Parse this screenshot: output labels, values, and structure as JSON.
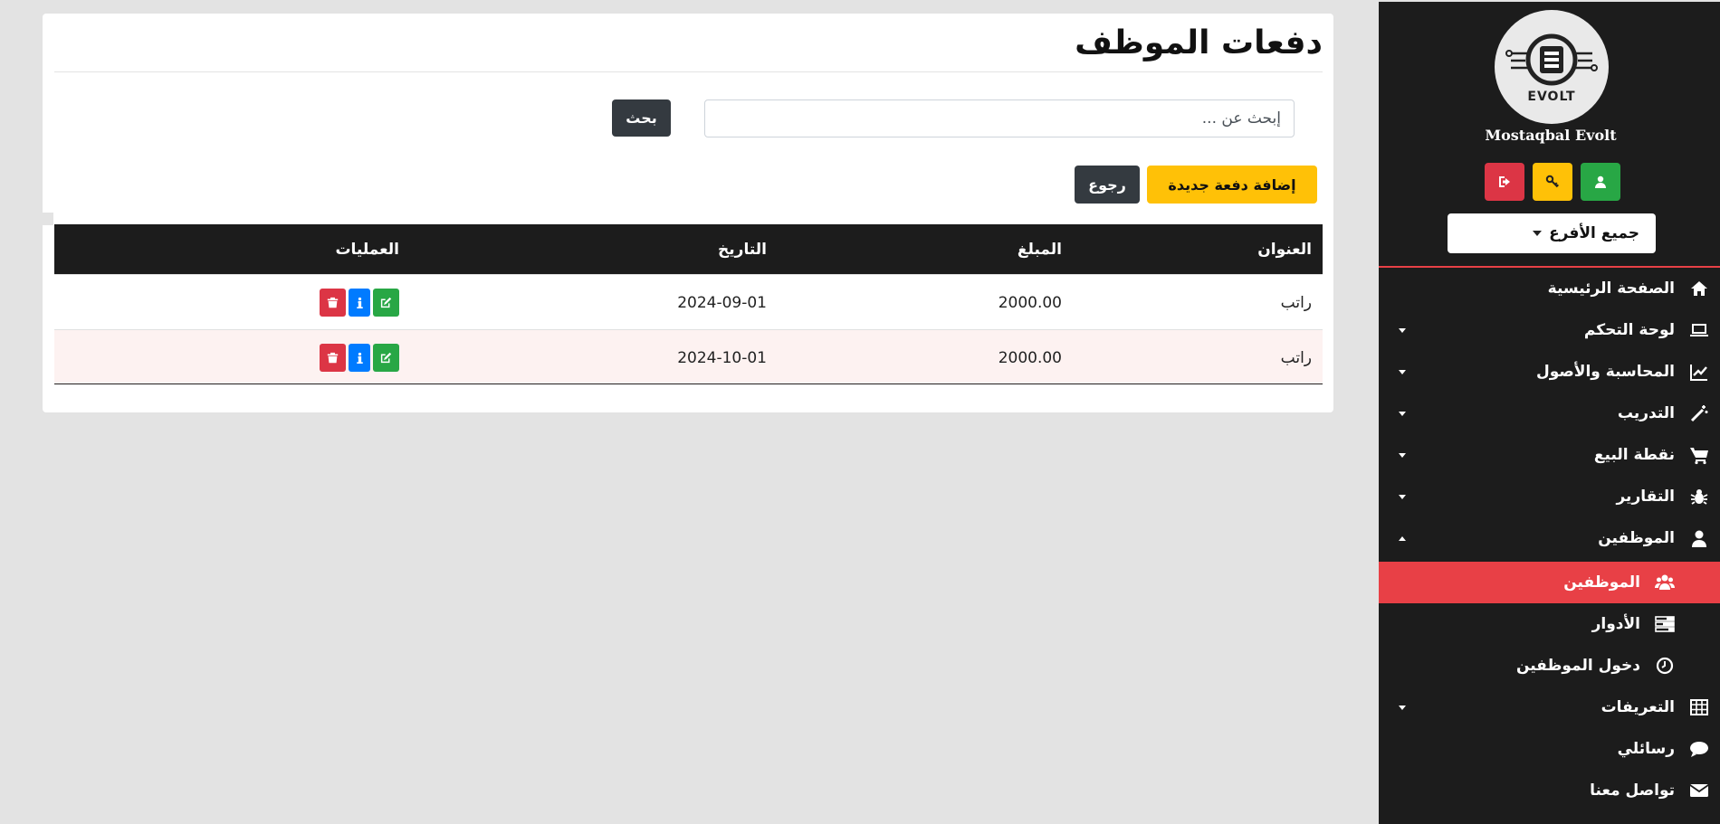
{
  "sidebar": {
    "brand": "Mostaqbal Evolt",
    "logo_text": "EVOLT",
    "branch_select": "جميع الأفرع",
    "nav": [
      {
        "label": "الصفحة الرئيسية",
        "icon": "home-icon"
      },
      {
        "label": "لوحة التحكم",
        "icon": "laptop-icon"
      },
      {
        "label": "المحاسبة والأصول",
        "icon": "line-chart-icon"
      },
      {
        "label": "التدريب",
        "icon": "magic-wand-icon"
      },
      {
        "label": "نقطة البيع",
        "icon": "cart-icon"
      },
      {
        "label": "التقارير",
        "icon": "bug-icon"
      },
      {
        "label": "الموظفين",
        "icon": "user-icon"
      }
    ],
    "sub_nav": [
      {
        "label": "الموظفين",
        "icon": "users-icon",
        "active": true
      },
      {
        "label": "الأدوار",
        "icon": "tasks-icon"
      },
      {
        "label": "دخول الموظفين",
        "icon": "clock-icon"
      }
    ],
    "nav_bottom": [
      {
        "label": "التعريفات",
        "icon": "table-icon"
      },
      {
        "label": "رسائلي",
        "icon": "comment-icon"
      },
      {
        "label": "تواصل معنا",
        "icon": "envelope-icon"
      }
    ],
    "accent_color": "#e84046"
  },
  "main": {
    "title": "دفعات الموظف",
    "search_placeholder": "إبحث عن ...",
    "search_button": "بحث",
    "add_button": "إضافة دفعة جديدة",
    "back_button": "رجوع"
  },
  "table": {
    "headers": [
      "العنوان",
      "المبلغ",
      "التاريخ",
      "العمليات"
    ],
    "rows": [
      {
        "title": "راتب",
        "amount": "2000.00",
        "date": "2024-09-01"
      },
      {
        "title": "راتب",
        "amount": "2000.00",
        "date": "2024-10-01"
      }
    ]
  }
}
